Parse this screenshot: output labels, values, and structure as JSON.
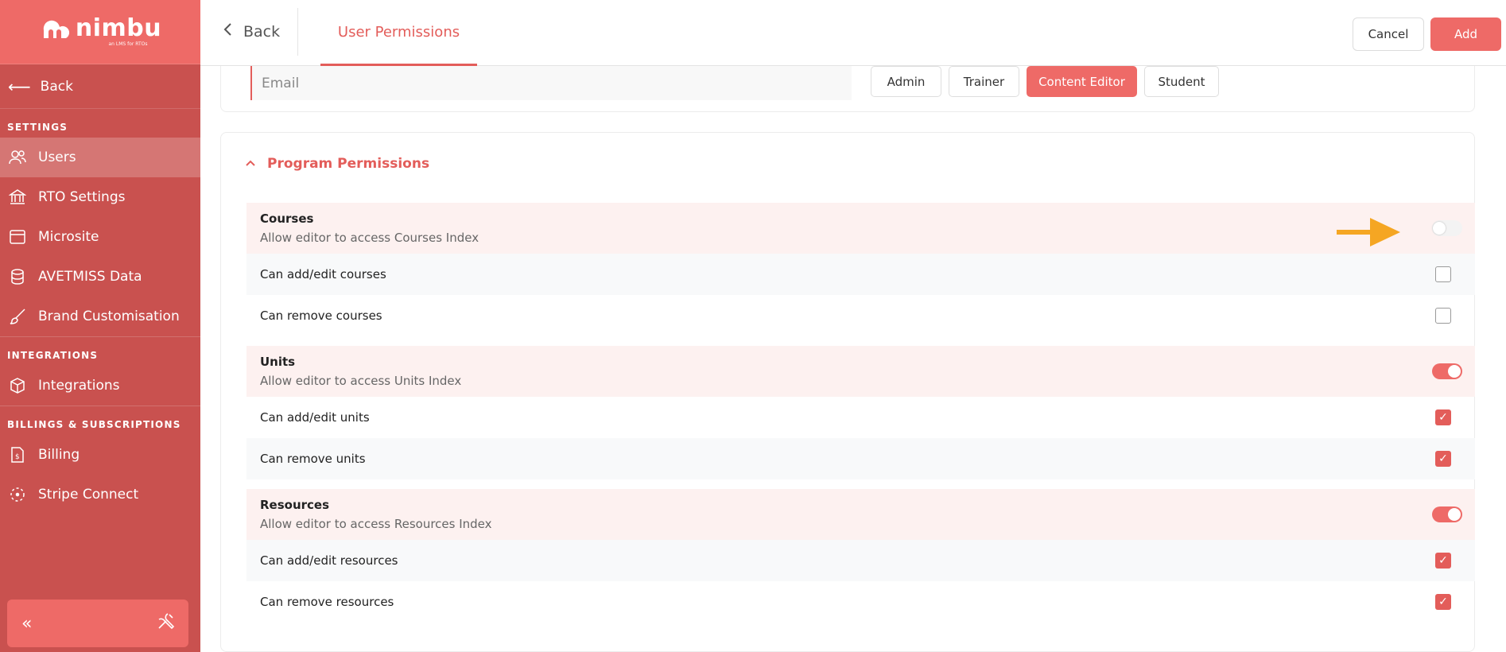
{
  "brand": {
    "name": "nimbu",
    "tagline": "an LMS for RTOs",
    "accent": "#ee6a67",
    "sidebar_bg": "#c9514f"
  },
  "sidebar": {
    "back_label": "Back",
    "sections": [
      {
        "title": "SETTINGS",
        "items": [
          {
            "label": "Users",
            "icon": "users-icon",
            "active": true
          },
          {
            "label": "RTO Settings",
            "icon": "bank-icon"
          },
          {
            "label": "Microsite",
            "icon": "browser-window-icon"
          },
          {
            "label": "AVETMISS Data",
            "icon": "database-icon"
          },
          {
            "label": "Brand Customisation",
            "icon": "brush-icon"
          }
        ]
      },
      {
        "title": "INTEGRATIONS",
        "items": [
          {
            "label": "Integrations",
            "icon": "cube-icon"
          }
        ]
      },
      {
        "title": "BILLINGS & SUBSCRIPTIONS",
        "items": [
          {
            "label": "Billing",
            "icon": "invoice-icon"
          },
          {
            "label": "Stripe Connect",
            "icon": "connect-icon"
          }
        ]
      }
    ],
    "footer": {
      "collapse_icon": "double-chevron-left-icon",
      "tools_icon": "tools-icon"
    }
  },
  "header": {
    "back_label": "Back",
    "tab_label": "User Permissions",
    "cancel_label": "Cancel",
    "add_label": "Add"
  },
  "user_form": {
    "email_placeholder": "Email",
    "roles": [
      {
        "label": "Admin",
        "active": false
      },
      {
        "label": "Trainer",
        "active": false
      },
      {
        "label": "Content Editor",
        "active": true
      },
      {
        "label": "Student",
        "active": false
      }
    ]
  },
  "program_permissions": {
    "title": "Program Permissions",
    "groups": [
      {
        "title": "Courses",
        "description": "Allow editor to access Courses Index",
        "enabled": false,
        "permissions": [
          {
            "label": "Can add/edit courses",
            "checked": false
          },
          {
            "label": "Can remove courses",
            "checked": false
          }
        ]
      },
      {
        "title": "Units",
        "description": "Allow editor to access Units Index",
        "enabled": true,
        "permissions": [
          {
            "label": "Can add/edit units",
            "checked": true
          },
          {
            "label": "Can remove units",
            "checked": true
          }
        ]
      },
      {
        "title": "Resources",
        "description": "Allow editor to access Resources Index",
        "enabled": true,
        "permissions": [
          {
            "label": "Can add/edit resources",
            "checked": true
          },
          {
            "label": "Can remove resources",
            "checked": true
          }
        ]
      }
    ]
  },
  "annotation": {
    "icon": "orange-arrow-icon",
    "color": "#f5a623"
  }
}
